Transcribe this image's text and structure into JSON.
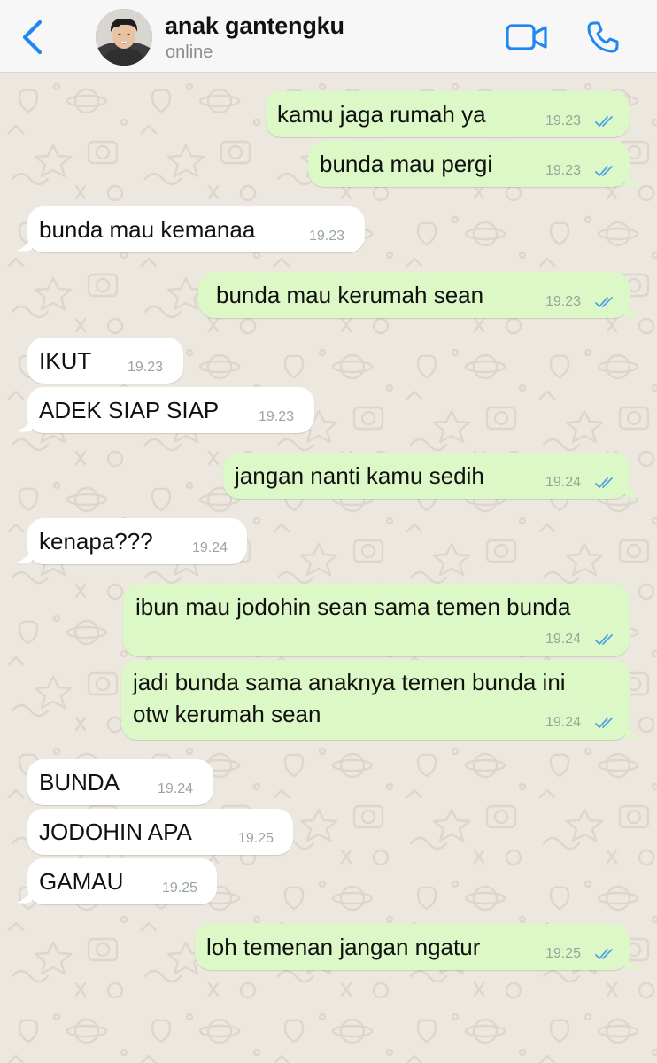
{
  "header": {
    "back_icon": "chevron-left-icon",
    "contact_name": "anak gantengku",
    "status": "online",
    "video_icon": "video-camera-icon",
    "call_icon": "phone-icon",
    "accent_color": "#1f86f2"
  },
  "messages": [
    {
      "direction": "out",
      "text": "kamu jaga rumah ya",
      "time": "19.23",
      "read": true
    },
    {
      "direction": "out",
      "text": "bunda mau pergi",
      "time": "19.23",
      "read": true
    },
    {
      "direction": "in",
      "text": "bunda mau kemanaa",
      "time": "19.23"
    },
    {
      "direction": "out",
      "text": "bunda mau kerumah sean",
      "time": "19.23",
      "read": true
    },
    {
      "direction": "in",
      "text": "IKUT",
      "time": "19.23"
    },
    {
      "direction": "in",
      "text": "ADEK SIAP SIAP",
      "time": "19.23"
    },
    {
      "direction": "out",
      "text": "jangan nanti kamu sedih",
      "time": "19.24",
      "read": true
    },
    {
      "direction": "in",
      "text": "kenapa???",
      "time": "19.24"
    },
    {
      "direction": "out",
      "text": "ibun mau jodohin sean sama temen bunda",
      "time": "19.24",
      "read": true
    },
    {
      "direction": "out",
      "lines": [
        "jadi bunda sama anaknya temen bunda ini",
        "otw kerumah sean"
      ],
      "time": "19.24",
      "read": true
    },
    {
      "direction": "in",
      "text": "BUNDA",
      "time": "19.24"
    },
    {
      "direction": "in",
      "text": "JODOHIN APA",
      "time": "19.25"
    },
    {
      "direction": "in",
      "text": "GAMAU",
      "time": "19.25"
    },
    {
      "direction": "out",
      "text": "loh temenan jangan ngatur",
      "time": "19.25",
      "read": true
    }
  ],
  "colors": {
    "outgoing_bubble": "#dcf8c6",
    "incoming_bubble": "#ffffff",
    "wallpaper": "#ece7df",
    "read_ticks": "#4fa3e0"
  }
}
